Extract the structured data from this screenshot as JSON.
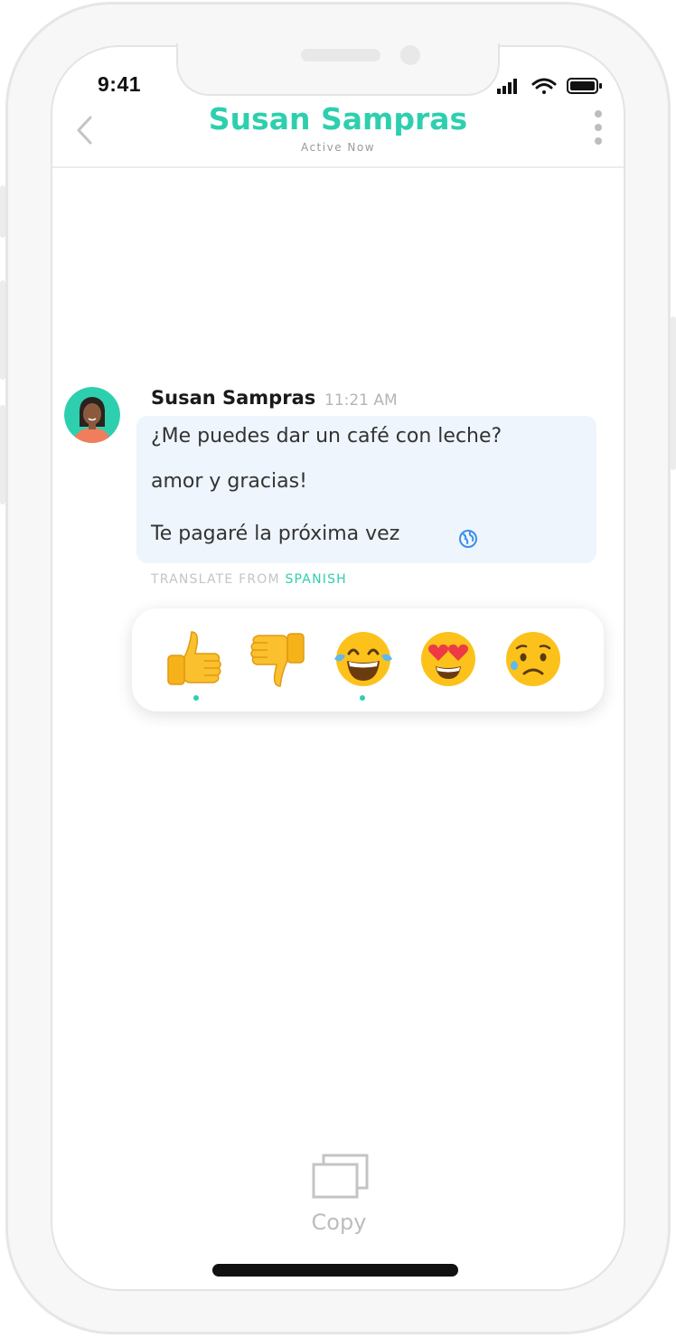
{
  "status_bar": {
    "time": "9:41"
  },
  "header": {
    "title": "Susan Sampras",
    "subtitle": "Active Now"
  },
  "message": {
    "sender": "Susan Sampras",
    "time": "11:21 AM",
    "lines": [
      "¿Me puedes dar un café con leche?",
      "amor y gracias!",
      "Te pagaré la próxima vez"
    ]
  },
  "translate": {
    "prefix": "TRANSLATE FROM",
    "language": "SPANISH"
  },
  "reactions": [
    {
      "icon": "thumbs-up-emoji",
      "selected": true
    },
    {
      "icon": "thumbs-down-emoji",
      "selected": false
    },
    {
      "icon": "tears-of-joy-emoji",
      "selected": true
    },
    {
      "icon": "heart-eyes-emoji",
      "selected": false
    },
    {
      "icon": "sad-sweat-emoji",
      "selected": false
    }
  ],
  "actions": {
    "copy_label": "Copy"
  },
  "colors": {
    "accent": "#2ecfae",
    "bubble": "#eef5fc",
    "frame": "#f7f7f7"
  }
}
